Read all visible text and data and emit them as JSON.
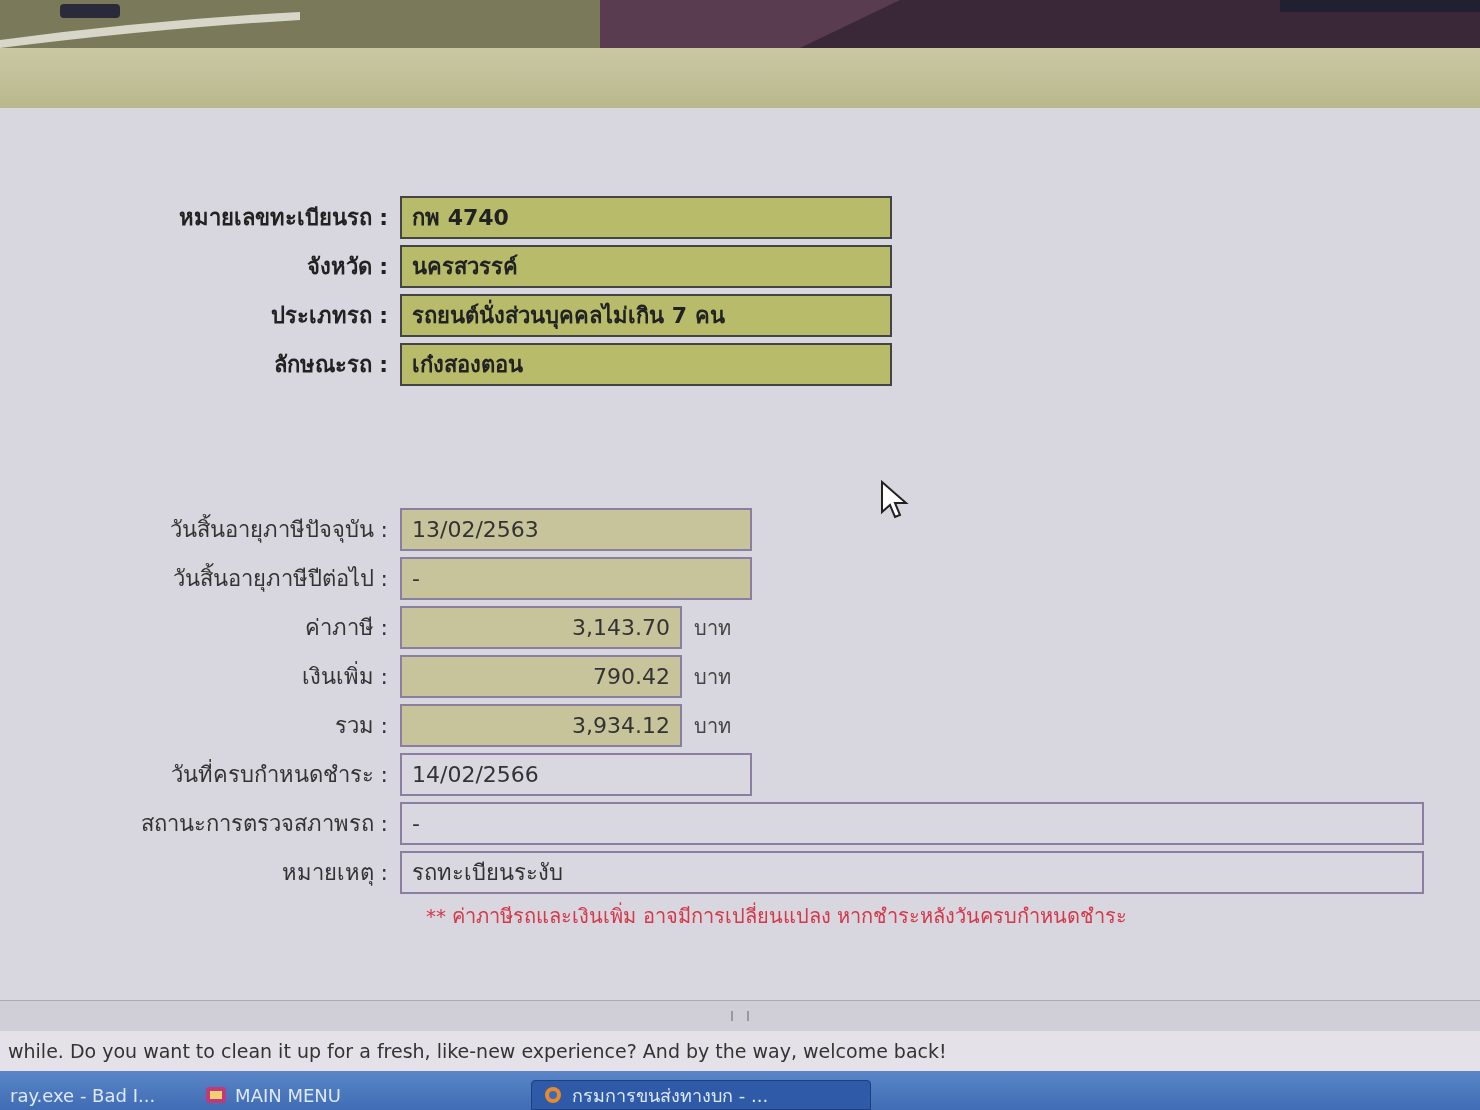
{
  "vehicle": [
    {
      "label": "หมายเลขทะเบียนรถ :",
      "value": "กพ 4740"
    },
    {
      "label": "จังหวัด :",
      "value": "นครสวรรค์"
    },
    {
      "label": "ประเภทรถ :",
      "value": "รถยนต์นั่งส่วนบุคคลไม่เกิน 7 คน"
    },
    {
      "label": "ลักษณะรถ :",
      "value": "เก๋งสองตอน"
    }
  ],
  "tax": [
    {
      "kind": "date",
      "highlighted": true,
      "label": "วันสิ้นอายุภาษีปัจจุบัน :",
      "value": "13/02/2563"
    },
    {
      "kind": "date",
      "highlighted": true,
      "label": "วันสิ้นอายุภาษีปีต่อไป :",
      "value": "-"
    },
    {
      "kind": "amount",
      "highlighted": true,
      "label": "ค่าภาษี :",
      "value": "3,143.70",
      "unit": "บาท"
    },
    {
      "kind": "amount",
      "highlighted": true,
      "label": "เงินเพิ่ม :",
      "value": "790.42",
      "unit": "บาท"
    },
    {
      "kind": "amount",
      "highlighted": true,
      "label": "รวม :",
      "value": "3,934.12",
      "unit": "บาท"
    },
    {
      "kind": "date",
      "highlighted": false,
      "label": "วันที่ครบกำหนดชำระ :",
      "value": "14/02/2566"
    },
    {
      "kind": "wide",
      "highlighted": false,
      "label": "สถานะการตรวจสภาพรถ :",
      "value": "-"
    },
    {
      "kind": "wide",
      "highlighted": false,
      "label": "หมายเหตุ :",
      "value": "รถทะเบียนระงับ"
    }
  ],
  "warning": "** ค่าภาษีรถและเงินเพิ่ม อาจมีการเปลี่ยนแปลง หากชำระหลังวันครบกำหนดชำระ",
  "notification": "while. Do you want to clean it up for a fresh, like-new experience? And by the way, welcome back!",
  "taskbar": [
    {
      "label": "ray.exe - Bad I...",
      "selected": false
    },
    {
      "label": "MAIN MENU",
      "selected": false
    },
    {
      "label": "กรมการขนส่งทางบก - ...",
      "selected": true
    }
  ]
}
